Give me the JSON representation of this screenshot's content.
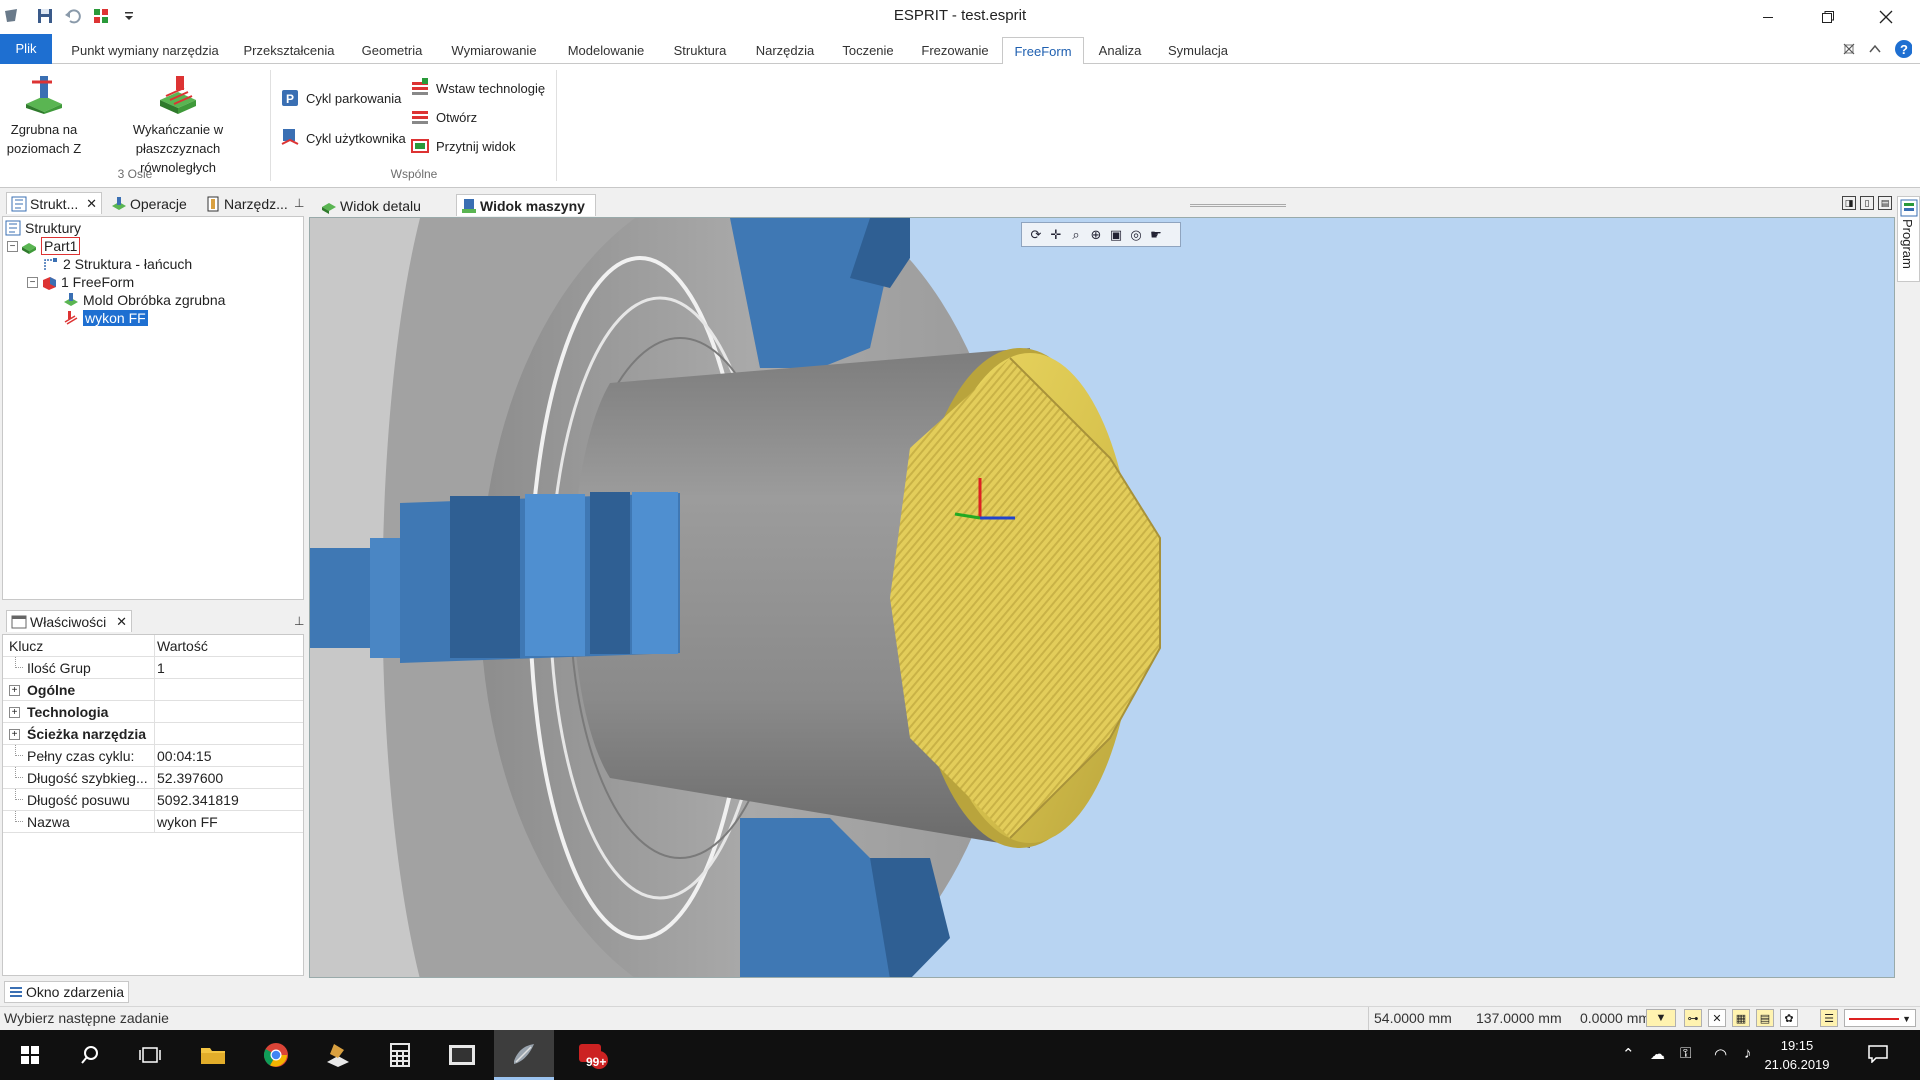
{
  "window": {
    "title": "ESPRIT - test.esprit",
    "controls": [
      "minimize",
      "restore",
      "close"
    ]
  },
  "ribbon": {
    "tabs": [
      {
        "label": "Plik"
      },
      {
        "label": "Punkt wymiany narzędzia"
      },
      {
        "label": "Przekształcenia"
      },
      {
        "label": "Geometria"
      },
      {
        "label": "Wymiarowanie"
      },
      {
        "label": "Modelowanie"
      },
      {
        "label": "Struktura"
      },
      {
        "label": "Narzędzia"
      },
      {
        "label": "Toczenie"
      },
      {
        "label": "Frezowanie"
      },
      {
        "label": "FreeForm"
      },
      {
        "label": "Analiza"
      },
      {
        "label": "Symulacja"
      }
    ],
    "active_tab": "FreeForm",
    "groups": {
      "osie": {
        "label": "3 Osie",
        "zgrubna": "Zgrubna na\npoziomach Z",
        "wykanczanie": "Wykańczanie w płaszczyznach\nrównoległych"
      },
      "wspolne": {
        "label": "Wspólne",
        "cykl_parkowania": "Cykl parkowania",
        "cykl_uzytkownika": "Cykl użytkownika",
        "wstaw": "Wstaw technologię",
        "otworz": "Otwórz",
        "przytnij": "Przytnij widok"
      }
    }
  },
  "left_panel": {
    "tabs": [
      "Strukt...",
      "Operacje",
      "Narzędz..."
    ],
    "tree": {
      "root": "Struktury",
      "part": "Part1",
      "chain": "2 Struktura - łańcuch",
      "freeform": "1 FreeForm",
      "mold": "Mold Obróbka zgrubna",
      "wykon": "wykon FF"
    }
  },
  "properties": {
    "tab": "Właściwości",
    "headers": {
      "key": "Klucz",
      "value": "Wartość"
    },
    "rows": [
      {
        "key": "Ilość Grup",
        "value": "1"
      },
      {
        "key": "Ogólne",
        "value": ""
      },
      {
        "key": "Technologia",
        "value": ""
      },
      {
        "key": "Ścieżka narzędzia",
        "value": ""
      },
      {
        "key": "Pełny czas cyklu:",
        "value": "00:04:15"
      },
      {
        "key": "Długość szybkieg...",
        "value": "52.397600"
      },
      {
        "key": "Długość posuwu",
        "value": "5092.341819"
      },
      {
        "key": "Nazwa",
        "value": "wykon FF"
      }
    ]
  },
  "view_tabs": [
    "Widok detalu",
    "Widok maszyny"
  ],
  "active_view": "Widok maszyny",
  "right_sidebar": {
    "label": "Program"
  },
  "event_window": "Okno zdarzenia",
  "status": {
    "message": "Wybierz następne zadanie",
    "x": "54.0000 mm",
    "y": "137.0000 mm",
    "z": "0.0000 mm"
  },
  "taskbar": {
    "time": "19:15",
    "date": "21.06.2019",
    "badge": "99+"
  },
  "colors": {
    "accent": "#1e6fd1",
    "viewport_bg": "#b8d4f2",
    "chuck": "#3f78b4",
    "part": "#d9c44f"
  }
}
